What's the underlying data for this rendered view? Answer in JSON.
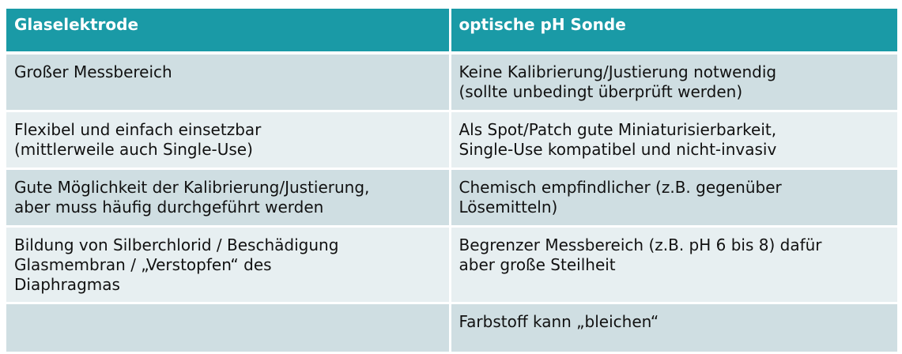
{
  "table": {
    "headers": [
      "Glaselektrode",
      "optische pH Sonde"
    ],
    "rows": [
      [
        "Großer Messbereich",
        "Keine Kalibrierung/Justierung notwendig\n(sollte unbedingt überprüft werden)"
      ],
      [
        "Flexibel und einfach einsetzbar\n(mittlerweile auch Single-Use)",
        "Als Spot/Patch gute Miniaturisierbarkeit,\nSingle-Use kompatibel und nicht-invasiv"
      ],
      [
        "Gute Möglichkeit der Kalibrierung/Justierung,\naber muss häufig durchgeführt werden",
        "Chemisch empfindlicher (z.B. gegenüber\nLösemitteln)"
      ],
      [
        "Bildung von Silberchlorid / Beschädigung\nGlasmembran / „Verstopfen“ des\nDiaphragmas",
        "Begrenzer Messbereich (z.B. pH 6 bis 8) dafür\naber große Steilheit"
      ],
      [
        "",
        "Farbstoff kann „bleichen“"
      ]
    ]
  },
  "colors": {
    "header_bg": "#1a9aa6",
    "row_dark": "#cfdee2",
    "row_light": "#e7eff1"
  }
}
